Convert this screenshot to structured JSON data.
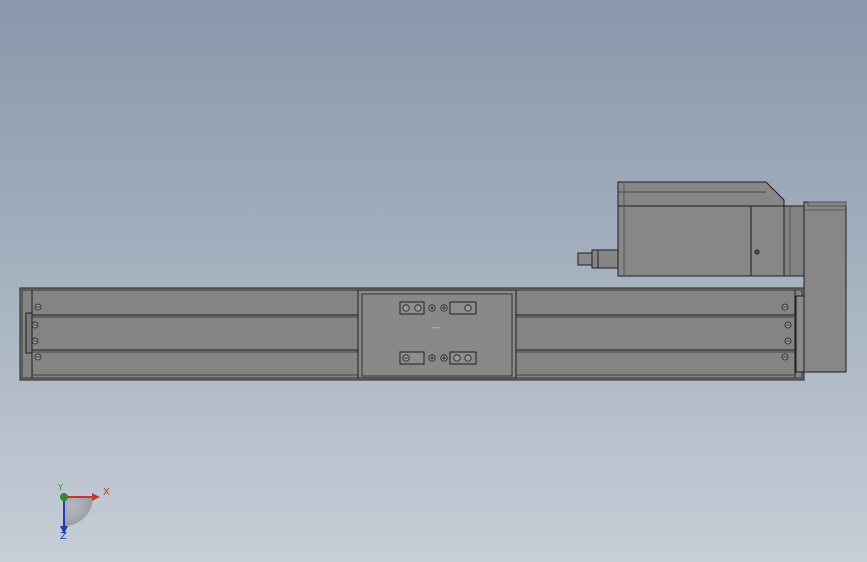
{
  "colors": {
    "background_top": "#8897aa",
    "background_bottom": "#c6ced7",
    "part_fill": "#878787",
    "part_fill_dark": "#7a7a7a",
    "edge": "#1e1e1e",
    "axis_x": "#c0392b",
    "axis_y": "#2e8b2e",
    "axis_z": "#1f3fb0"
  },
  "triad": {
    "x_label": "X",
    "y_label": "Y",
    "z_label": "Z"
  },
  "carriage": {
    "center_mark": "—"
  }
}
